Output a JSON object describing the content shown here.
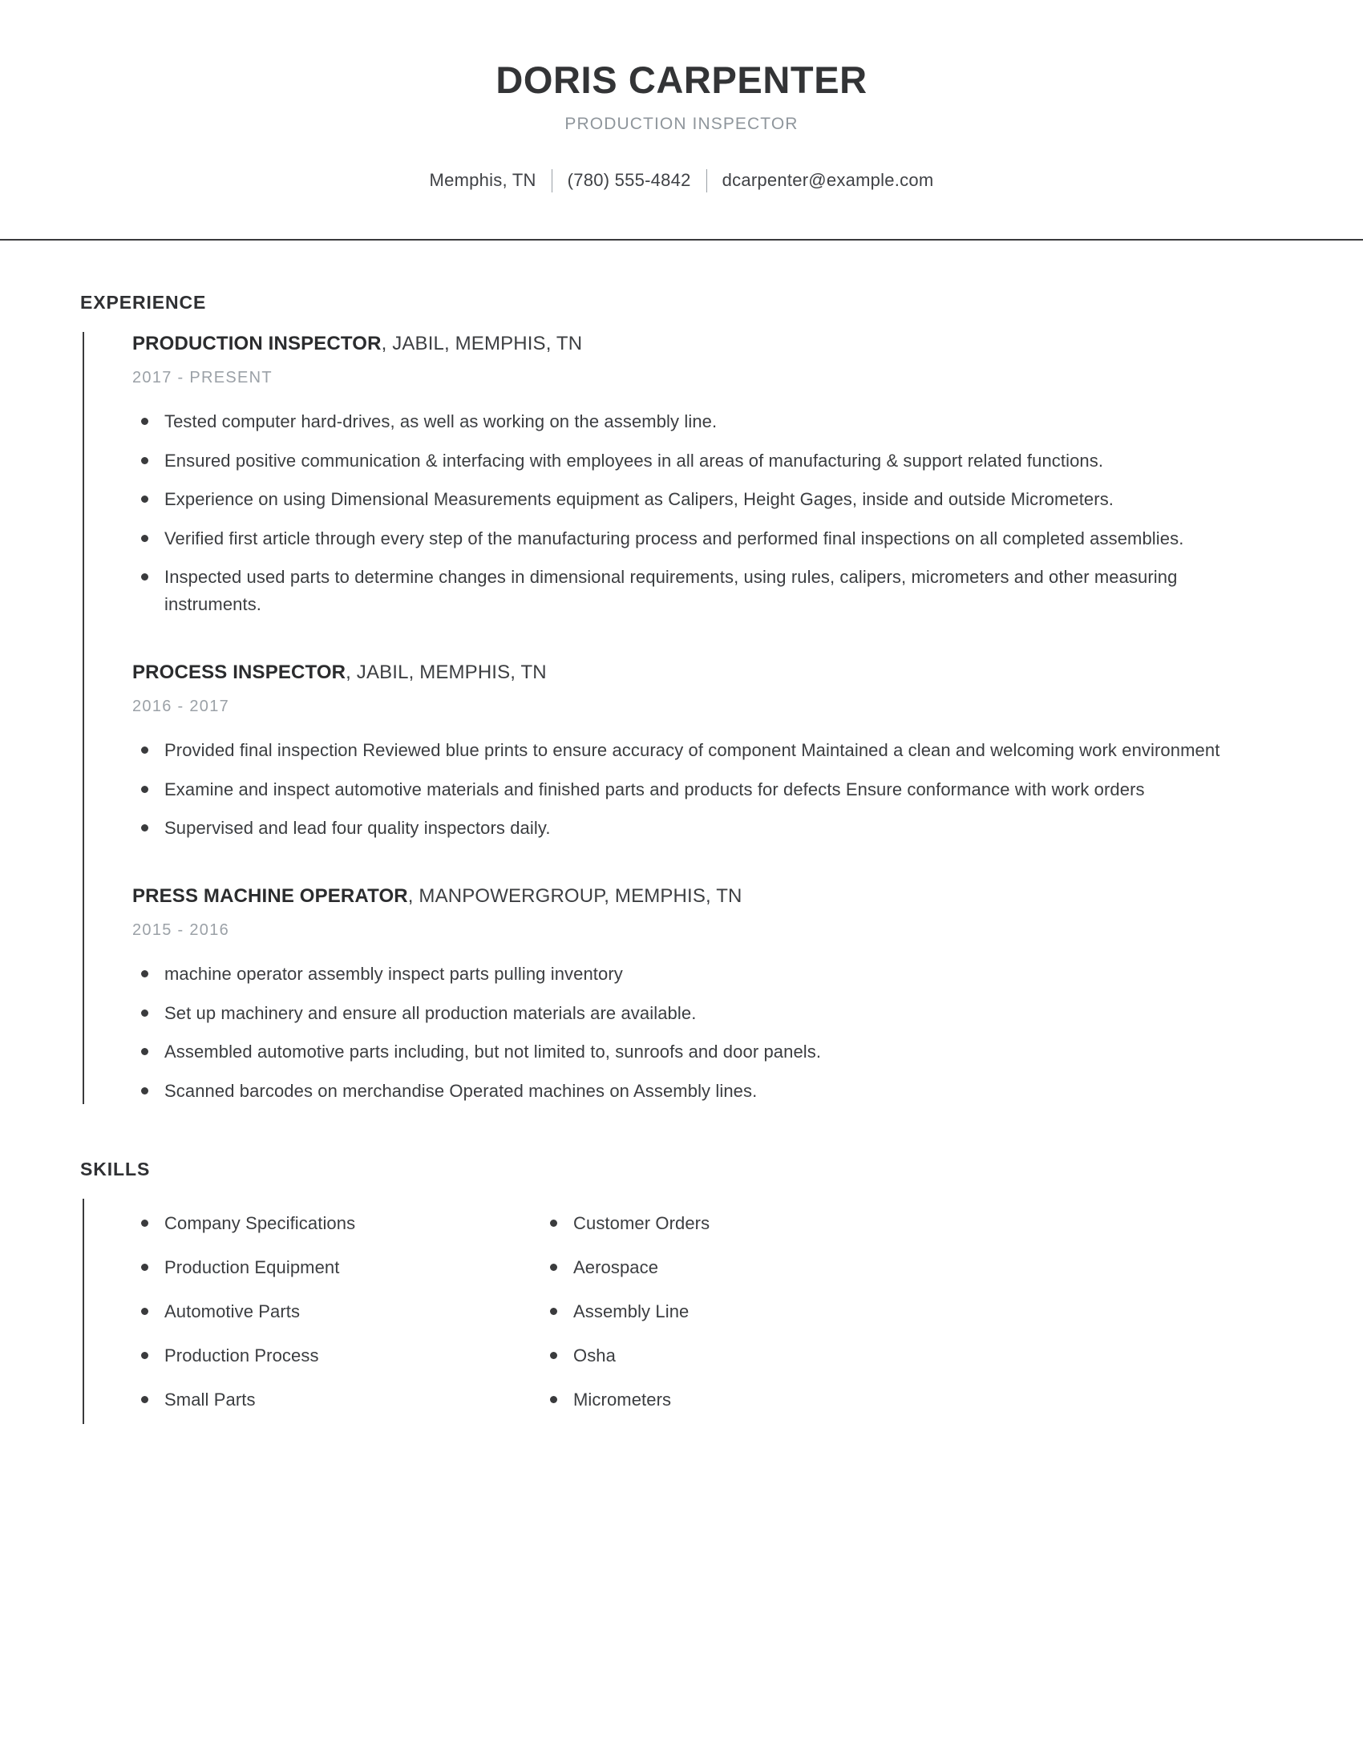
{
  "header": {
    "name": "DORIS CARPENTER",
    "subtitle": "PRODUCTION INSPECTOR",
    "contact": {
      "location": "Memphis, TN",
      "phone": "(780) 555-4842",
      "email": "dcarpenter@example.com"
    }
  },
  "colors": {
    "text": "#3b3d40",
    "heading": "#2f3033",
    "muted": "#9ba1a7",
    "rule": "#3a3a3c"
  },
  "sections": {
    "experience": {
      "title": "EXPERIENCE",
      "jobs": [
        {
          "title": "PRODUCTION INSPECTOR",
          "company": ", JABIL, MEMPHIS, TN",
          "dates": "2017 - PRESENT",
          "bullets": [
            "Tested computer hard-drives, as well as working on the assembly line.",
            "Ensured positive communication & interfacing with employees in all areas of manufacturing & support related functions.",
            "Experience on using Dimensional Measurements equipment as Calipers, Height Gages, inside and outside Micrometers.",
            "Verified first article through every step of the manufacturing process and performed final inspections on all completed assemblies.",
            "Inspected used parts to determine changes in dimensional requirements, using rules, calipers, micrometers and other measuring instruments."
          ]
        },
        {
          "title": "PROCESS INSPECTOR",
          "company": ", JABIL, MEMPHIS, TN",
          "dates": "2016 - 2017",
          "bullets": [
            "Provided final inspection Reviewed blue prints to ensure accuracy of component Maintained a clean and welcoming work environment",
            "Examine and inspect automotive materials and finished parts and products for defects Ensure conformance with work orders",
            "Supervised and lead four quality inspectors daily."
          ]
        },
        {
          "title": "PRESS MACHINE OPERATOR",
          "company": ", MANPOWERGROUP, MEMPHIS, TN",
          "dates": "2015 - 2016",
          "bullets": [
            "machine operator assembly inspect parts pulling inventory",
            "Set up machinery and ensure all production materials are available.",
            "Assembled automotive parts including, but not limited to, sunroofs and door panels.",
            "Scanned barcodes on merchandise Operated machines on Assembly lines."
          ]
        }
      ]
    },
    "skills": {
      "title": "SKILLS",
      "column_left": [
        "Company Specifications",
        "Production Equipment",
        "Automotive Parts",
        "Production Process",
        "Small Parts"
      ],
      "column_right": [
        "Customer Orders",
        "Aerospace",
        "Assembly Line",
        "Osha",
        "Micrometers"
      ]
    }
  }
}
